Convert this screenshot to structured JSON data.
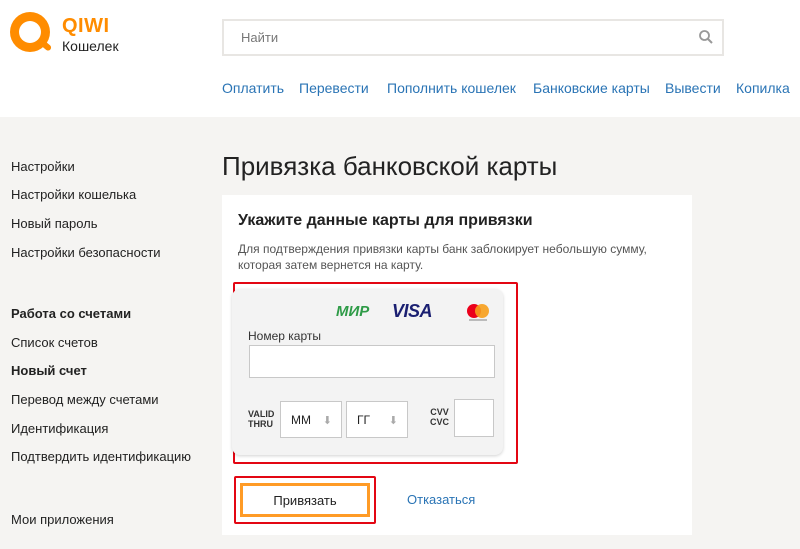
{
  "logo": {
    "name": "QIWI",
    "subtitle": "Кошелек"
  },
  "search": {
    "placeholder": "Найти"
  },
  "nav": [
    "Оплатить",
    "Перевести",
    "Пополнить кошелек",
    "Банковские карты",
    "Вывести",
    "Копилка"
  ],
  "sidebar": {
    "group1": [
      "Настройки",
      "Настройки кошелька",
      "Новый пароль",
      "Настройки безопасности"
    ],
    "group2_title": "Работа со счетами",
    "group2": [
      "Список счетов",
      "Новый счет",
      "Перевод между счетами",
      "Идентификация",
      "Подтвердить идентификацию"
    ],
    "group3": [
      "Мои приложения"
    ]
  },
  "page": {
    "title": "Привязка банковской карты"
  },
  "card": {
    "heading": "Укажите данные карты для привязки",
    "description": "Для подтверждения привязки карты банк заблокирует небольшую сумму, которая затем вернется на карту.",
    "brands": {
      "mir": "МИР",
      "visa": "VISA"
    },
    "number_label": "Номер карты",
    "number_value": "",
    "valid_label_1": "VALID",
    "valid_label_2": "THRU",
    "month_placeholder": "ММ",
    "year_placeholder": "ГГ",
    "cvv_label_1": "CVV",
    "cvv_label_2": "CVC",
    "cvv_value": ""
  },
  "actions": {
    "submit": "Привязать",
    "cancel": "Отказаться"
  },
  "colors": {
    "accent": "#ff8c00",
    "link": "#2a74b5",
    "highlight": "#e30613",
    "button_border": "#ff9b26"
  }
}
